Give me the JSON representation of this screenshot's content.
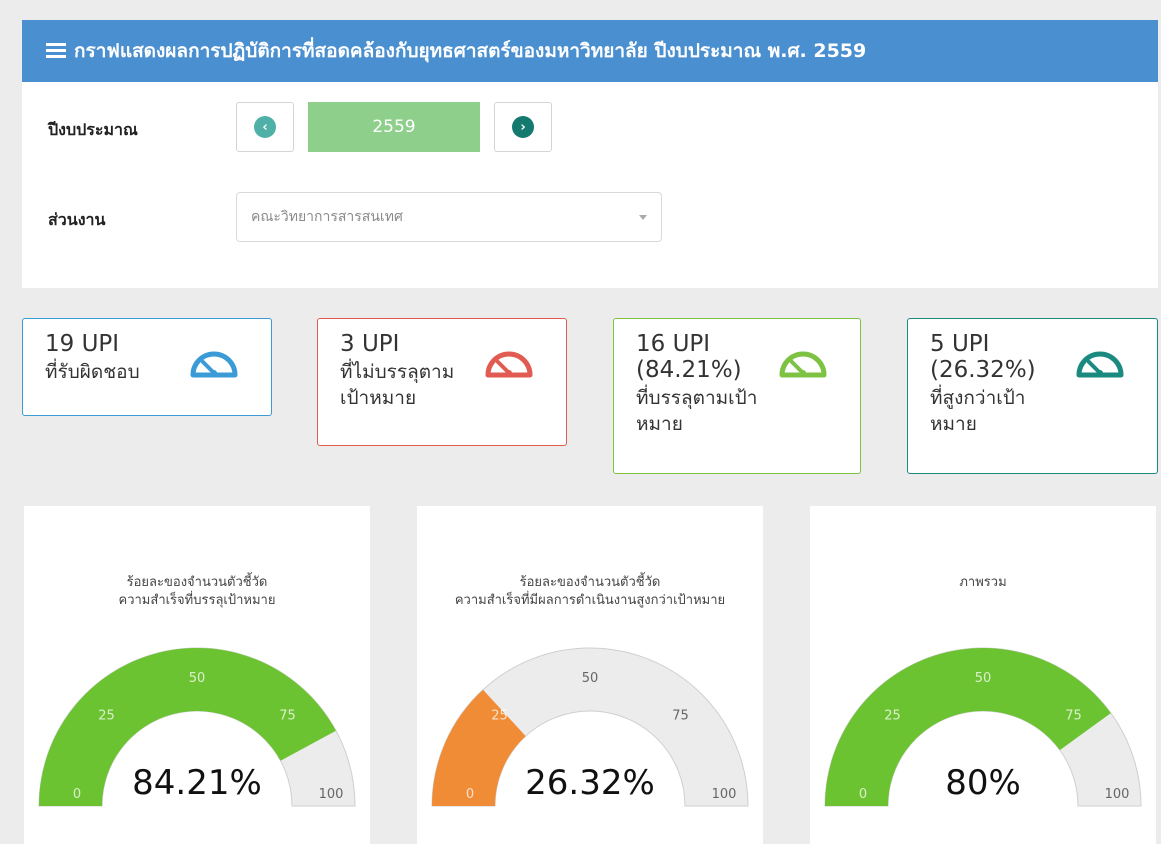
{
  "header": {
    "title": "กราฟแสดงผลการปฏิบัติการที่สอดคล้องกับยุทธศาสตร์ของมหาวิทยาลัย ปีงบประมาณ พ.ศ. 2559",
    "icon": "list-icon"
  },
  "filters": {
    "year_label": "ปีงบประมาณ",
    "year_value": "2559",
    "prev_icon": "chevron-left-circle-icon",
    "next_icon": "chevron-right-circle-icon",
    "unit_label": "ส่วนงาน",
    "unit_value": "คณะวิทยาการสารสนเทศ"
  },
  "stats": [
    {
      "count": "19 UPI",
      "percent": "",
      "desc1": "ที่รับผิดชอบ",
      "desc2": "",
      "color": "#3a9bd6",
      "icon": "gauge-icon"
    },
    {
      "count": "3 UPI",
      "percent": "",
      "desc1": "ที่ไม่บรรลุตาม",
      "desc2": "เป้าหมาย",
      "color": "#e25b52",
      "icon": "gauge-icon"
    },
    {
      "count": "16 UPI",
      "percent": "(84.21%)",
      "desc1": "ที่บรรลุตามเป้า",
      "desc2": "หมาย",
      "color": "#7dc243",
      "icon": "gauge-icon"
    },
    {
      "count": "5 UPI",
      "percent": "(26.32%)",
      "desc1": "ที่สูงกว่าเป้า",
      "desc2": "หมาย",
      "color": "#1a8a80",
      "icon": "gauge-icon"
    }
  ],
  "gauges": [
    {
      "title1": "ร้อยละของจำนวนตัวชี้วัด",
      "title2": "ความสำเร็จที่บรรลุเป้าหมาย",
      "value": 84.21,
      "label": "84.21%",
      "color": "#6cc332"
    },
    {
      "title1": "ร้อยละของจำนวนตัวชี้วัด",
      "title2": "ความสำเร็จที่มีผลการดำเนินงานสูงกว่าเป้าหมาย",
      "value": 26.32,
      "label": "26.32%",
      "color": "#f08c35"
    },
    {
      "title1": "ภาพรวม",
      "title2": "",
      "value": 80,
      "label": "80%",
      "color": "#6cc332"
    }
  ],
  "chart_data": [
    {
      "type": "gauge",
      "min": 0,
      "max": 100,
      "ticks": [
        0,
        25,
        50,
        75,
        100
      ],
      "value": 84.21,
      "label": "84.21%"
    },
    {
      "type": "gauge",
      "min": 0,
      "max": 100,
      "ticks": [
        0,
        25,
        50,
        75,
        100
      ],
      "value": 26.32,
      "label": "26.32%"
    },
    {
      "type": "gauge",
      "min": 0,
      "max": 100,
      "ticks": [
        0,
        25,
        50,
        75,
        100
      ],
      "value": 80,
      "label": "80%"
    }
  ]
}
